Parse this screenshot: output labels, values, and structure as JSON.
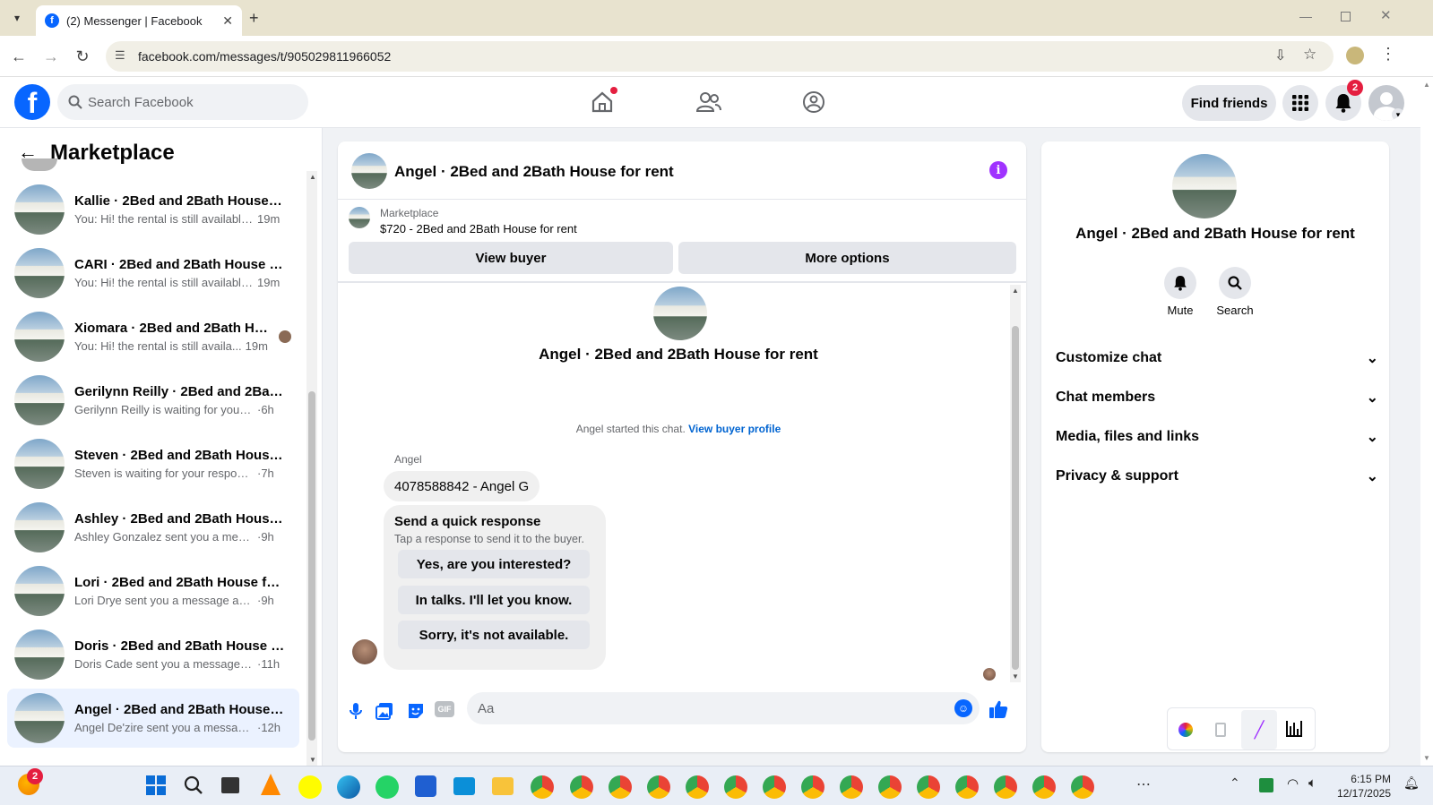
{
  "browser": {
    "tab_title": "(2) Messenger | Facebook",
    "url": "facebook.com/messages/t/905029811966052"
  },
  "fb_header": {
    "search_placeholder": "Search Facebook",
    "find_friends": "Find friends",
    "notification_count": "2",
    "accent": "#0866ff"
  },
  "left": {
    "title": "Marketplace",
    "conversations": [
      {
        "title": "Kallie · 2Bed and 2Bath House f...",
        "preview": "You: Hi! the rental is still available...",
        "time": "19m"
      },
      {
        "title": "CARI · 2Bed and 2Bath House fo...",
        "preview": "You: Hi! the rental is still available...",
        "time": "19m"
      },
      {
        "title": "Xiomara · 2Bed and 2Bath Ho...",
        "preview": "You: Hi! the rental is still availa...",
        "time": "19m"
      },
      {
        "title": "Gerilynn Reilly · 2Bed and 2Bath...",
        "preview": "Gerilynn Reilly is waiting for your r...",
        "time": "·6h"
      },
      {
        "title": "Steven · 2Bed and 2Bath House ...",
        "preview": "Steven is waiting for your response.",
        "time": "·7h"
      },
      {
        "title": "Ashley · 2Bed and 2Bath House ...",
        "preview": "Ashley Gonzalez sent you a messa...",
        "time": "·9h"
      },
      {
        "title": "Lori · 2Bed and 2Bath House for...",
        "preview": "Lori Drye sent you a message abou...",
        "time": "·9h"
      },
      {
        "title": "Doris · 2Bed and 2Bath House f...",
        "preview": "Doris Cade sent you a message a...",
        "time": "·11h"
      },
      {
        "title": "Angel · 2Bed and 2Bath House f...",
        "preview": "Angel De'zire sent you a message...",
        "time": "·12h"
      }
    ]
  },
  "chat": {
    "title": "Angel · 2Bed and 2Bath House for rent",
    "listing_source": "Marketplace",
    "listing": "$720 - 2Bed and 2Bath House for rent",
    "view_buyer": "View buyer",
    "more_options": "More options",
    "intro_name": "Angel · 2Bed and 2Bath House for rent",
    "started_text": "Angel started this chat.",
    "view_buyer_profile": "View buyer profile",
    "sender": "Angel",
    "message": "4078588842 - Angel G",
    "quick_title": "Send a quick response",
    "quick_sub": "Tap a response to send it to the buyer.",
    "quick_responses": [
      "Yes, are you interested?",
      "In talks. I'll let you know.",
      "Sorry, it's not available."
    ],
    "composer_placeholder": "Aa"
  },
  "right": {
    "name": "Angel · 2Bed and 2Bath House for rent",
    "mute": "Mute",
    "search": "Search",
    "sections": [
      "Customize chat",
      "Chat members",
      "Media, files and links",
      "Privacy & support"
    ]
  },
  "taskbar": {
    "time": "6:15 PM",
    "date": "12/17/2025",
    "weather_badge": "2"
  }
}
